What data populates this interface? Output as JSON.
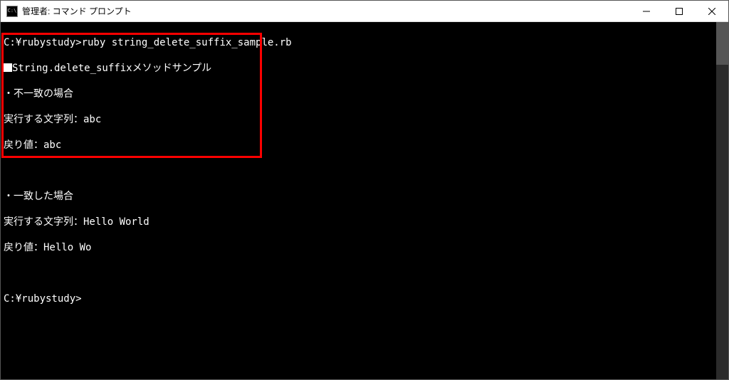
{
  "window": {
    "title": "管理者: コマンド プロンプト",
    "icon_label": "C:\\"
  },
  "terminal": {
    "prompt1_prefix": "C:¥rubystudy>",
    "prompt1_command": "ruby string_delete_suffix_sample.rb",
    "output": {
      "header": "String.delete_suffixメソッドサンプル",
      "section1_title": "・不一致の場合",
      "section1_line1": "実行する文字列：abc",
      "section1_line2": "戻り値：abc",
      "blank": "",
      "section2_title": "・一致した場合",
      "section2_line1": "実行する文字列：Hello World",
      "section2_line2": "戻り値：Hello Wo"
    },
    "prompt2": "C:¥rubystudy>"
  }
}
